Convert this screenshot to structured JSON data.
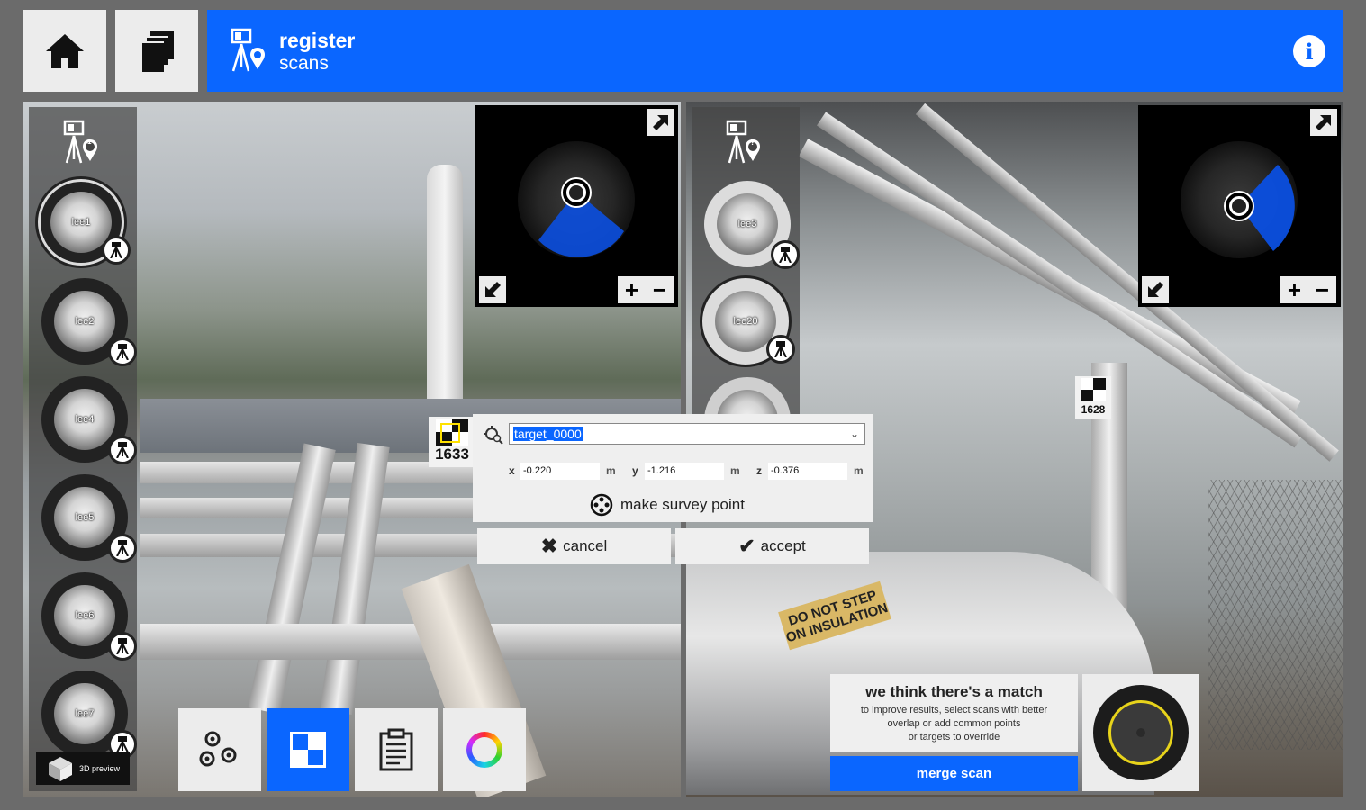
{
  "toolbar": {
    "home_icon": "home-icon",
    "pages_icon": "copy-pages-icon",
    "app_title": "register",
    "app_subtitle": "scans",
    "info_icon": "info-icon"
  },
  "left_panel": {
    "scan_group_badge": "1",
    "scans": [
      {
        "label": "lee1",
        "selected": true
      },
      {
        "label": "lee2",
        "selected": false
      },
      {
        "label": "lee4",
        "selected": false
      },
      {
        "label": "lee5",
        "selected": false
      },
      {
        "label": "lee6",
        "selected": false
      },
      {
        "label": "lee7",
        "selected": false
      }
    ],
    "preview_label": "3D preview",
    "plate_text": "1633"
  },
  "right_panel": {
    "scan_group_badge": "?",
    "scans": [
      {
        "label": "lee3",
        "selected": false
      },
      {
        "label": "lee20",
        "selected": true
      }
    ],
    "plate_text": "1628",
    "sticker_line1": "DO NOT STEP",
    "sticker_line2": "ON INSULATION"
  },
  "target_dialog": {
    "target_name": "target_0000",
    "x_label": "x",
    "x_value": "-0.220",
    "y_label": "y",
    "y_value": "-1.216",
    "z_label": "z",
    "z_value": "-0.376",
    "unit": "m",
    "survey_label": "make survey point",
    "cancel_label": "cancel",
    "accept_label": "accept"
  },
  "bottom_tools": [
    {
      "icon": "circles-icon",
      "active": false
    },
    {
      "icon": "checkerboard-target-icon",
      "active": true
    },
    {
      "icon": "clipboard-icon",
      "active": false
    },
    {
      "icon": "color-wheel-icon",
      "active": false
    }
  ],
  "match": {
    "title": "we think there's a match",
    "desc1": "to improve results, select scans with better",
    "desc2": "overlap or add common points",
    "desc3": "or targets to override",
    "merge_label": "merge scan"
  },
  "colors": {
    "accent": "#0a66ff",
    "frame": "#6b6b6b",
    "tile": "#ececec",
    "map_cone": "#0b4fe0",
    "dial_ring": "#e7d31b"
  }
}
